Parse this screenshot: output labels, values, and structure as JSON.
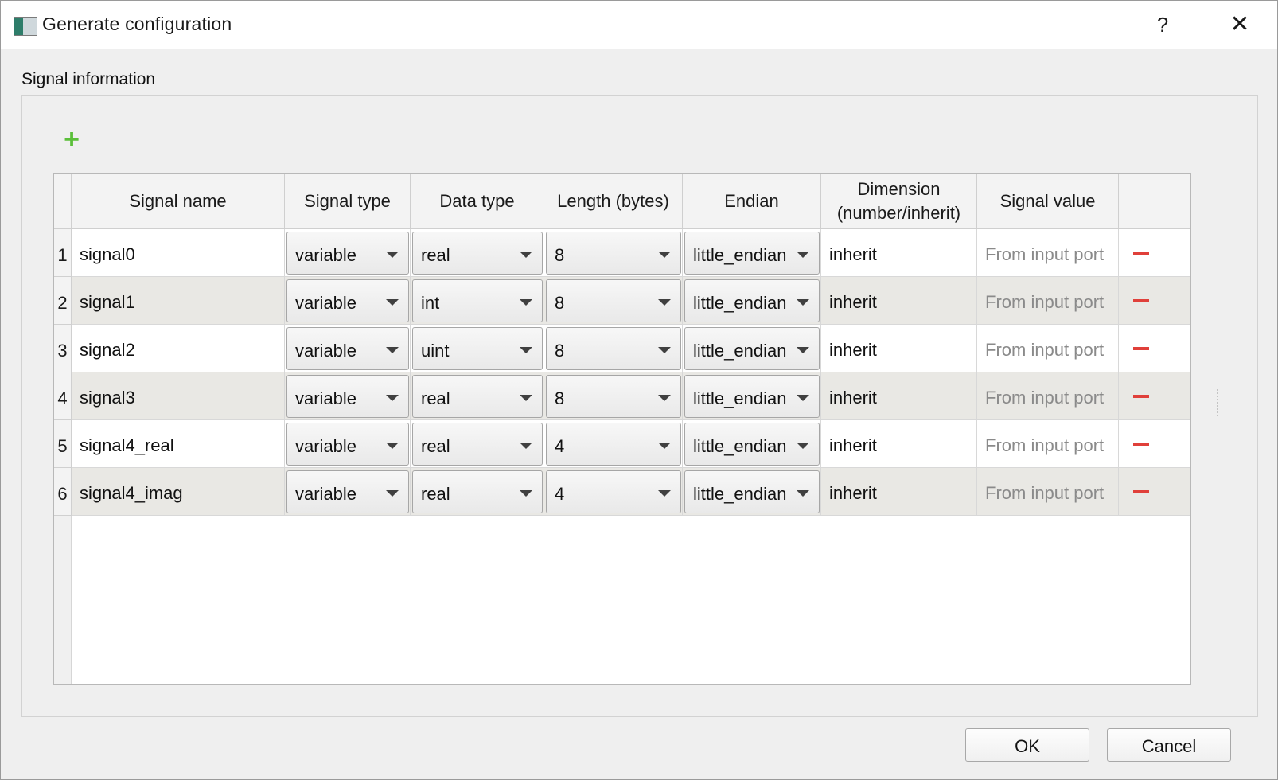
{
  "window": {
    "title": "Generate configuration",
    "help_label": "?",
    "close_label": "✕"
  },
  "group": {
    "label": "Signal information",
    "add_label": "+"
  },
  "table": {
    "headers": [
      "Signal name",
      "Signal type",
      "Data type",
      "Length (bytes)",
      "Endian",
      "Dimension\n(number/inherit)",
      "Signal value",
      ""
    ],
    "rows": [
      {
        "num": "1",
        "name": "signal0",
        "signal_type": "variable",
        "data_type": "real",
        "length": "8",
        "endian": "little_endian",
        "dimension": "inherit",
        "value_placeholder": "From input port"
      },
      {
        "num": "2",
        "name": "signal1",
        "signal_type": "variable",
        "data_type": "int",
        "length": "8",
        "endian": "little_endian",
        "dimension": "inherit",
        "value_placeholder": "From input port"
      },
      {
        "num": "3",
        "name": "signal2",
        "signal_type": "variable",
        "data_type": "uint",
        "length": "8",
        "endian": "little_endian",
        "dimension": "inherit",
        "value_placeholder": "From input port"
      },
      {
        "num": "4",
        "name": "signal3",
        "signal_type": "variable",
        "data_type": "real",
        "length": "8",
        "endian": "little_endian",
        "dimension": "inherit",
        "value_placeholder": "From input port"
      },
      {
        "num": "5",
        "name": "signal4_real",
        "signal_type": "variable",
        "data_type": "real",
        "length": "4",
        "endian": "little_endian",
        "dimension": "inherit",
        "value_placeholder": "From input port"
      },
      {
        "num": "6",
        "name": "signal4_imag",
        "signal_type": "variable",
        "data_type": "real",
        "length": "4",
        "endian": "little_endian",
        "dimension": "inherit",
        "value_placeholder": "From input port"
      }
    ]
  },
  "buttons": {
    "ok": "OK",
    "cancel": "Cancel"
  },
  "colors": {
    "add_icon": "#5bbf3a",
    "remove_icon": "#e0403a",
    "alt_row": "#e9e8e4"
  },
  "icons": {
    "add": "plus-icon",
    "remove": "minus-icon",
    "dropdown": "chevron-down-icon"
  }
}
